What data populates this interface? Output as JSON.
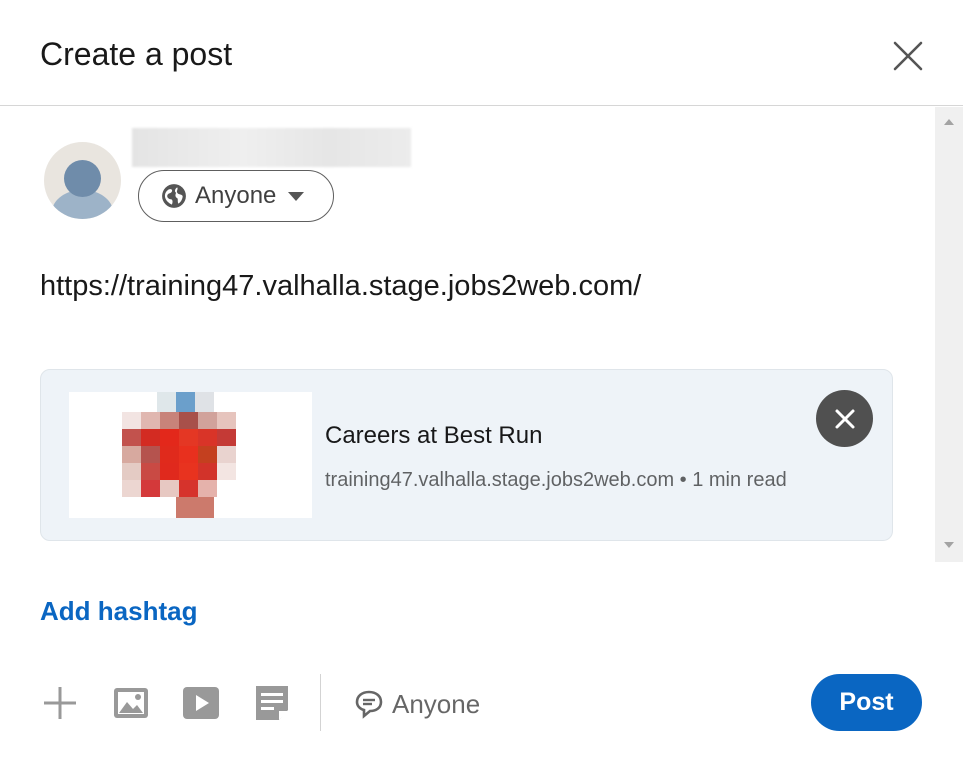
{
  "dialog": {
    "title": "Create a post"
  },
  "author": {
    "audience_label": "Anyone"
  },
  "post": {
    "text": "https://training47.valhalla.stage.jobs2web.com/"
  },
  "link_preview": {
    "title": "Careers at Best Run",
    "subtitle": "training47.valhalla.stage.jobs2web.com • 1 min read"
  },
  "add_hashtag_label": "Add hashtag",
  "toolbar": {
    "icons": [
      "plus-icon",
      "image-icon",
      "video-icon",
      "document-icon",
      "comment-icon"
    ],
    "comment_audience_label": "Anyone",
    "post_label": "Post"
  },
  "colors": {
    "accent": "#0a66c2",
    "preview_bg": "#eef3f8"
  }
}
